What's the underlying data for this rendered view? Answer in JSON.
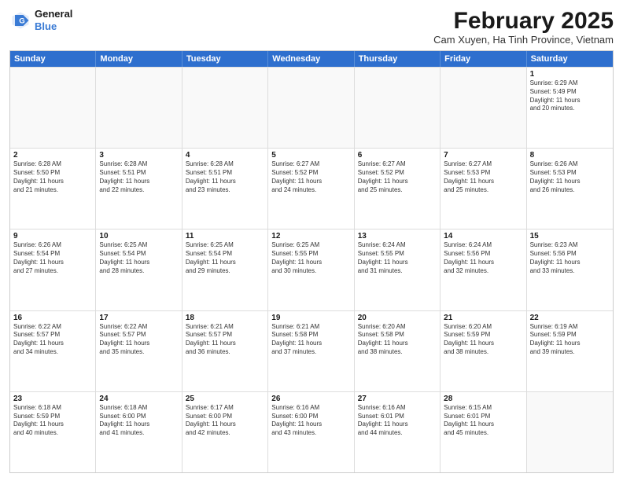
{
  "logo": {
    "line1": "General",
    "line2": "Blue"
  },
  "title": "February 2025",
  "location": "Cam Xuyen, Ha Tinh Province, Vietnam",
  "header": {
    "days": [
      "Sunday",
      "Monday",
      "Tuesday",
      "Wednesday",
      "Thursday",
      "Friday",
      "Saturday"
    ]
  },
  "weeks": [
    [
      {
        "day": "",
        "text": ""
      },
      {
        "day": "",
        "text": ""
      },
      {
        "day": "",
        "text": ""
      },
      {
        "day": "",
        "text": ""
      },
      {
        "day": "",
        "text": ""
      },
      {
        "day": "",
        "text": ""
      },
      {
        "day": "1",
        "text": "Sunrise: 6:29 AM\nSunset: 5:49 PM\nDaylight: 11 hours\nand 20 minutes."
      }
    ],
    [
      {
        "day": "2",
        "text": "Sunrise: 6:28 AM\nSunset: 5:50 PM\nDaylight: 11 hours\nand 21 minutes."
      },
      {
        "day": "3",
        "text": "Sunrise: 6:28 AM\nSunset: 5:51 PM\nDaylight: 11 hours\nand 22 minutes."
      },
      {
        "day": "4",
        "text": "Sunrise: 6:28 AM\nSunset: 5:51 PM\nDaylight: 11 hours\nand 23 minutes."
      },
      {
        "day": "5",
        "text": "Sunrise: 6:27 AM\nSunset: 5:52 PM\nDaylight: 11 hours\nand 24 minutes."
      },
      {
        "day": "6",
        "text": "Sunrise: 6:27 AM\nSunset: 5:52 PM\nDaylight: 11 hours\nand 25 minutes."
      },
      {
        "day": "7",
        "text": "Sunrise: 6:27 AM\nSunset: 5:53 PM\nDaylight: 11 hours\nand 25 minutes."
      },
      {
        "day": "8",
        "text": "Sunrise: 6:26 AM\nSunset: 5:53 PM\nDaylight: 11 hours\nand 26 minutes."
      }
    ],
    [
      {
        "day": "9",
        "text": "Sunrise: 6:26 AM\nSunset: 5:54 PM\nDaylight: 11 hours\nand 27 minutes."
      },
      {
        "day": "10",
        "text": "Sunrise: 6:25 AM\nSunset: 5:54 PM\nDaylight: 11 hours\nand 28 minutes."
      },
      {
        "day": "11",
        "text": "Sunrise: 6:25 AM\nSunset: 5:54 PM\nDaylight: 11 hours\nand 29 minutes."
      },
      {
        "day": "12",
        "text": "Sunrise: 6:25 AM\nSunset: 5:55 PM\nDaylight: 11 hours\nand 30 minutes."
      },
      {
        "day": "13",
        "text": "Sunrise: 6:24 AM\nSunset: 5:55 PM\nDaylight: 11 hours\nand 31 minutes."
      },
      {
        "day": "14",
        "text": "Sunrise: 6:24 AM\nSunset: 5:56 PM\nDaylight: 11 hours\nand 32 minutes."
      },
      {
        "day": "15",
        "text": "Sunrise: 6:23 AM\nSunset: 5:56 PM\nDaylight: 11 hours\nand 33 minutes."
      }
    ],
    [
      {
        "day": "16",
        "text": "Sunrise: 6:22 AM\nSunset: 5:57 PM\nDaylight: 11 hours\nand 34 minutes."
      },
      {
        "day": "17",
        "text": "Sunrise: 6:22 AM\nSunset: 5:57 PM\nDaylight: 11 hours\nand 35 minutes."
      },
      {
        "day": "18",
        "text": "Sunrise: 6:21 AM\nSunset: 5:57 PM\nDaylight: 11 hours\nand 36 minutes."
      },
      {
        "day": "19",
        "text": "Sunrise: 6:21 AM\nSunset: 5:58 PM\nDaylight: 11 hours\nand 37 minutes."
      },
      {
        "day": "20",
        "text": "Sunrise: 6:20 AM\nSunset: 5:58 PM\nDaylight: 11 hours\nand 38 minutes."
      },
      {
        "day": "21",
        "text": "Sunrise: 6:20 AM\nSunset: 5:59 PM\nDaylight: 11 hours\nand 38 minutes."
      },
      {
        "day": "22",
        "text": "Sunrise: 6:19 AM\nSunset: 5:59 PM\nDaylight: 11 hours\nand 39 minutes."
      }
    ],
    [
      {
        "day": "23",
        "text": "Sunrise: 6:18 AM\nSunset: 5:59 PM\nDaylight: 11 hours\nand 40 minutes."
      },
      {
        "day": "24",
        "text": "Sunrise: 6:18 AM\nSunset: 6:00 PM\nDaylight: 11 hours\nand 41 minutes."
      },
      {
        "day": "25",
        "text": "Sunrise: 6:17 AM\nSunset: 6:00 PM\nDaylight: 11 hours\nand 42 minutes."
      },
      {
        "day": "26",
        "text": "Sunrise: 6:16 AM\nSunset: 6:00 PM\nDaylight: 11 hours\nand 43 minutes."
      },
      {
        "day": "27",
        "text": "Sunrise: 6:16 AM\nSunset: 6:01 PM\nDaylight: 11 hours\nand 44 minutes."
      },
      {
        "day": "28",
        "text": "Sunrise: 6:15 AM\nSunset: 6:01 PM\nDaylight: 11 hours\nand 45 minutes."
      },
      {
        "day": "",
        "text": ""
      }
    ]
  ]
}
